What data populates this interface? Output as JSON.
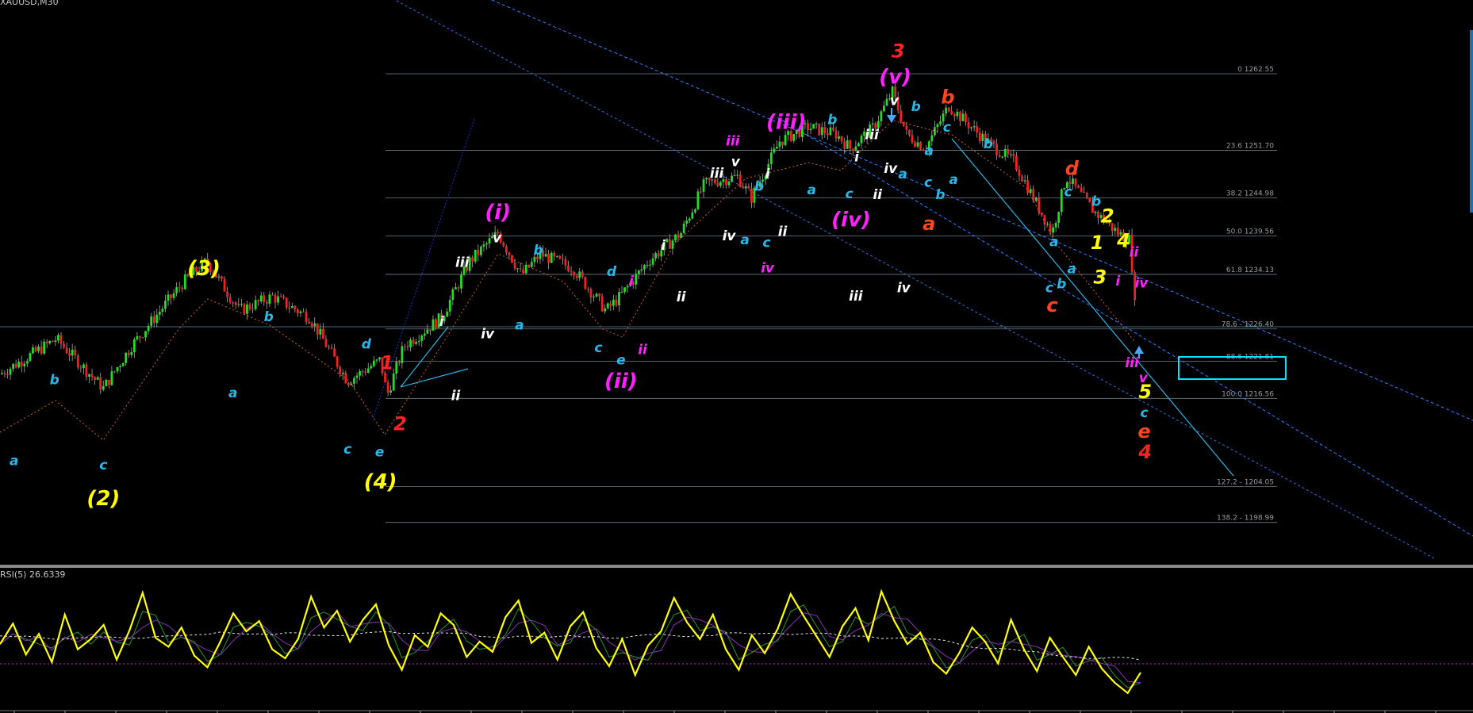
{
  "window": {
    "symbol_label": "XAUUSD,M30",
    "indicator_label": "RSI(5) 26.6339"
  },
  "colors": {
    "bg": "#000000",
    "bull": "#22dd22",
    "bear": "#ee2222",
    "wick": "#aaaaaa",
    "fib": "#9aa6b0",
    "rsi": "#ffff00",
    "channel": "#2f7fff",
    "trend": "#29b6e8",
    "box": "#00e5ff"
  },
  "chart_data": [
    {
      "type": "candlestick",
      "title": "",
      "ylim": [
        1193,
        1273
      ],
      "waypoints": [
        [
          0,
          1220
        ],
        [
          60,
          1225
        ],
        [
          110,
          1218
        ],
        [
          140,
          1224
        ],
        [
          195,
          1233
        ],
        [
          220,
          1236
        ],
        [
          255,
          1229
        ],
        [
          290,
          1231
        ],
        [
          330,
          1228
        ],
        [
          370,
          1219
        ],
        [
          405,
          1222
        ],
        [
          412,
          1217
        ],
        [
          430,
          1224
        ],
        [
          470,
          1228
        ],
        [
          500,
          1236
        ],
        [
          530,
          1240
        ],
        [
          555,
          1234
        ],
        [
          575,
          1237
        ],
        [
          610,
          1235
        ],
        [
          645,
          1229
        ],
        [
          660,
          1231
        ],
        [
          690,
          1236
        ],
        [
          725,
          1240
        ],
        [
          750,
          1247
        ],
        [
          785,
          1248
        ],
        [
          800,
          1245
        ],
        [
          830,
          1253
        ],
        [
          860,
          1255
        ],
        [
          890,
          1254
        ],
        [
          905,
          1252
        ],
        [
          930,
          1255
        ],
        [
          950,
          1260
        ],
        [
          965,
          1254
        ],
        [
          985,
          1252
        ],
        [
          1010,
          1258
        ],
        [
          1050,
          1253
        ],
        [
          1080,
          1250
        ],
        [
          1120,
          1240
        ],
        [
          1135,
          1248
        ],
        [
          1165,
          1243
        ],
        [
          1190,
          1240
        ],
        [
          1203,
          1239
        ],
        [
          1210,
          1226
        ]
      ],
      "fib_levels": [
        {
          "label": "0 1262.55",
          "value": 1262.55
        },
        {
          "label": "23.6 1251.70",
          "value": 1251.7
        },
        {
          "label": "38.2 1244.98",
          "value": 1244.98
        },
        {
          "label": "50.0 1239.56",
          "value": 1239.56
        },
        {
          "label": "61.8 1234.13",
          "value": 1234.13
        },
        {
          "label": "78.6 - 1226.40",
          "value": 1226.4
        },
        {
          "label": "88.6 1221.81",
          "value": 1221.81
        },
        {
          "label": "100.0 1216.56",
          "value": 1216.56
        },
        {
          "label": "127.2 - 1204.05",
          "value": 1204.05
        },
        {
          "label": "138.2 - 1198.99",
          "value": 1198.99
        }
      ],
      "wave_labels": [
        {
          "text": "a",
          "x": 15,
          "y": 495,
          "color": "#29b6e8"
        },
        {
          "text": "b",
          "x": 58,
          "y": 409,
          "color": "#29b6e8"
        },
        {
          "text": "c",
          "x": 110,
          "y": 500,
          "color": "#29b6e8"
        },
        {
          "text": "(2)",
          "x": 110,
          "y": 538,
          "color": "#ffff00"
        },
        {
          "text": "(3)",
          "x": 217,
          "y": 293,
          "color": "#ffff00"
        },
        {
          "text": "a",
          "x": 248,
          "y": 423,
          "color": "#29b6e8"
        },
        {
          "text": "b",
          "x": 286,
          "y": 342,
          "color": "#29b6e8"
        },
        {
          "text": "d",
          "x": 390,
          "y": 371,
          "color": "#29b6e8"
        },
        {
          "text": "c",
          "x": 370,
          "y": 483,
          "color": "#29b6e8"
        },
        {
          "text": "e",
          "x": 404,
          "y": 486,
          "color": "#29b6e8"
        },
        {
          "text": "(4)",
          "x": 405,
          "y": 520,
          "color": "#ffff00"
        },
        {
          "text": "1",
          "x": 412,
          "y": 393,
          "color": "#ff2222"
        },
        {
          "text": "2",
          "x": 426,
          "y": 458,
          "color": "#ff2222"
        },
        {
          "text": "i",
          "x": 470,
          "y": 347,
          "color": "#ffffff"
        },
        {
          "text": "ii",
          "x": 485,
          "y": 426,
          "color": "#ffffff"
        },
        {
          "text": "iii",
          "x": 492,
          "y": 284,
          "color": "#ffffff"
        },
        {
          "text": "iv",
          "x": 519,
          "y": 360,
          "color": "#ffffff"
        },
        {
          "text": "v",
          "x": 529,
          "y": 258,
          "color": "#ffffff"
        },
        {
          "text": "(i)",
          "x": 530,
          "y": 233,
          "color": "#ff22ff"
        },
        {
          "text": "a",
          "x": 553,
          "y": 351,
          "color": "#29b6e8"
        },
        {
          "text": "b",
          "x": 573,
          "y": 271,
          "color": "#29b6e8"
        },
        {
          "text": "d",
          "x": 651,
          "y": 294,
          "color": "#29b6e8"
        },
        {
          "text": "i",
          "x": 672,
          "y": 304,
          "color": "#ff22ff"
        },
        {
          "text": "c",
          "x": 637,
          "y": 375,
          "color": "#29b6e8"
        },
        {
          "text": "e",
          "x": 661,
          "y": 388,
          "color": "#29b6e8"
        },
        {
          "text": "ii",
          "x": 684,
          "y": 377,
          "color": "#ff22ff"
        },
        {
          "text": "(ii)",
          "x": 661,
          "y": 413,
          "color": "#ff22ff"
        },
        {
          "text": "i",
          "x": 706,
          "y": 266,
          "color": "#ffffff"
        },
        {
          "text": "ii",
          "x": 725,
          "y": 321,
          "color": "#ffffff"
        },
        {
          "text": "iii",
          "x": 763,
          "y": 189,
          "color": "#ffffff"
        },
        {
          "text": "v",
          "x": 783,
          "y": 177,
          "color": "#ffffff"
        },
        {
          "text": "iii",
          "x": 780,
          "y": 155,
          "color": "#ff22ff"
        },
        {
          "text": "iv",
          "x": 776,
          "y": 256,
          "color": "#ffffff"
        },
        {
          "text": "a",
          "x": 793,
          "y": 260,
          "color": "#29b6e8"
        },
        {
          "text": "b",
          "x": 808,
          "y": 203,
          "color": "#29b6e8"
        },
        {
          "text": "i",
          "x": 817,
          "y": 190,
          "color": "#ffffff"
        },
        {
          "text": "c",
          "x": 816,
          "y": 263,
          "color": "#29b6e8"
        },
        {
          "text": "ii",
          "x": 833,
          "y": 251,
          "color": "#ffffff"
        },
        {
          "text": "iv",
          "x": 817,
          "y": 290,
          "color": "#ff22ff"
        },
        {
          "text": "(iii)",
          "x": 837,
          "y": 137,
          "color": "#ff22ff"
        },
        {
          "text": "b",
          "x": 886,
          "y": 132,
          "color": "#29b6e8"
        },
        {
          "text": "a",
          "x": 864,
          "y": 207,
          "color": "#29b6e8"
        },
        {
          "text": "c",
          "x": 904,
          "y": 211,
          "color": "#29b6e8"
        },
        {
          "text": "i",
          "x": 912,
          "y": 172,
          "color": "#ffffff"
        },
        {
          "text": "ii",
          "x": 934,
          "y": 212,
          "color": "#ffffff"
        },
        {
          "text": "iii",
          "x": 928,
          "y": 148,
          "color": "#ffffff"
        },
        {
          "text": "iv",
          "x": 948,
          "y": 184,
          "color": "#ffffff"
        },
        {
          "text": "(iv)",
          "x": 906,
          "y": 241,
          "color": "#ff22ff"
        },
        {
          "text": "iii",
          "x": 911,
          "y": 320,
          "color": "#ffffff"
        },
        {
          "text": "iv",
          "x": 962,
          "y": 311,
          "color": "#ffffff"
        },
        {
          "text": "a",
          "x": 961,
          "y": 190,
          "color": "#29b6e8"
        },
        {
          "text": "3",
          "x": 956,
          "y": 61,
          "color": "#ff2222"
        },
        {
          "text": "(v)",
          "x": 953,
          "y": 89,
          "color": "#ff22ff"
        },
        {
          "text": "v",
          "x": 952,
          "y": 112,
          "color": "#ffffff"
        },
        {
          "text": "b",
          "x": 975,
          "y": 118,
          "color": "#29b6e8"
        },
        {
          "text": "b",
          "x": 1009,
          "y": 110,
          "color": "#ff4422"
        },
        {
          "text": "c",
          "x": 1008,
          "y": 140,
          "color": "#29b6e8"
        },
        {
          "text": "a",
          "x": 989,
          "y": 165,
          "color": "#29b6e8"
        },
        {
          "text": "c",
          "x": 988,
          "y": 199,
          "color": "#29b6e8"
        },
        {
          "text": "b",
          "x": 1001,
          "y": 212,
          "color": "#29b6e8"
        },
        {
          "text": "a",
          "x": 1015,
          "y": 196,
          "color": "#29b6e8"
        },
        {
          "text": "a",
          "x": 989,
          "y": 245,
          "color": "#ff4422"
        },
        {
          "text": "b",
          "x": 1052,
          "y": 158,
          "color": "#29b6e8"
        },
        {
          "text": "d",
          "x": 1141,
          "y": 186,
          "color": "#ff4422"
        },
        {
          "text": "c",
          "x": 1137,
          "y": 209,
          "color": "#29b6e8"
        },
        {
          "text": "b",
          "x": 1167,
          "y": 219,
          "color": "#29b6e8"
        },
        {
          "text": "2",
          "x": 1179,
          "y": 237,
          "color": "#ffff00"
        },
        {
          "text": "a",
          "x": 1122,
          "y": 262,
          "color": "#29b6e8"
        },
        {
          "text": "1",
          "x": 1168,
          "y": 265,
          "color": "#ffff00"
        },
        {
          "text": "4",
          "x": 1196,
          "y": 263,
          "color": "#ffff00"
        },
        {
          "text": "ii",
          "x": 1207,
          "y": 273,
          "color": "#ff22ff"
        },
        {
          "text": "a",
          "x": 1141,
          "y": 291,
          "color": "#29b6e8"
        },
        {
          "text": "b",
          "x": 1130,
          "y": 307,
          "color": "#29b6e8"
        },
        {
          "text": "c",
          "x": 1117,
          "y": 311,
          "color": "#29b6e8"
        },
        {
          "text": "3",
          "x": 1171,
          "y": 302,
          "color": "#ffff00"
        },
        {
          "text": "i",
          "x": 1190,
          "y": 304,
          "color": "#ff22ff"
        },
        {
          "text": "iv",
          "x": 1215,
          "y": 306,
          "color": "#ff22ff"
        },
        {
          "text": "c",
          "x": 1120,
          "y": 332,
          "color": "#ff4422"
        },
        {
          "text": "iii",
          "x": 1205,
          "y": 391,
          "color": "#ff22ff"
        },
        {
          "text": "v",
          "x": 1217,
          "y": 407,
          "color": "#ff22ff"
        },
        {
          "text": "5",
          "x": 1219,
          "y": 424,
          "color": "#ffff00"
        },
        {
          "text": "c",
          "x": 1218,
          "y": 444,
          "color": "#29b6e8"
        },
        {
          "text": "e",
          "x": 1218,
          "y": 466,
          "color": "#ff4422"
        },
        {
          "text": "4",
          "x": 1219,
          "y": 488,
          "color": "#ff2222"
        }
      ]
    },
    {
      "type": "line",
      "title": "RSI(5) 26.6339",
      "ylim": [
        0,
        100
      ],
      "series": [
        {
          "name": "RSI(5)",
          "values": [
            48,
            64,
            40,
            56,
            34,
            71,
            44,
            52,
            63,
            36,
            59,
            88,
            53,
            46,
            61,
            39,
            30,
            50,
            72,
            58,
            66,
            44,
            37,
            52,
            85,
            61,
            74,
            50,
            67,
            79,
            47,
            28,
            55,
            46,
            72,
            63,
            38,
            50,
            42,
            69,
            82,
            49,
            57,
            36,
            62,
            73,
            45,
            31,
            52,
            24,
            47,
            58,
            84,
            65,
            52,
            71,
            44,
            28,
            55,
            41,
            60,
            87,
            70,
            54,
            38,
            62,
            76,
            51,
            89,
            66,
            48,
            57,
            34,
            25,
            41,
            61,
            50,
            33,
            67,
            44,
            27,
            53,
            38,
            24,
            46,
            29,
            18,
            10,
            26
          ]
        }
      ]
    }
  ]
}
